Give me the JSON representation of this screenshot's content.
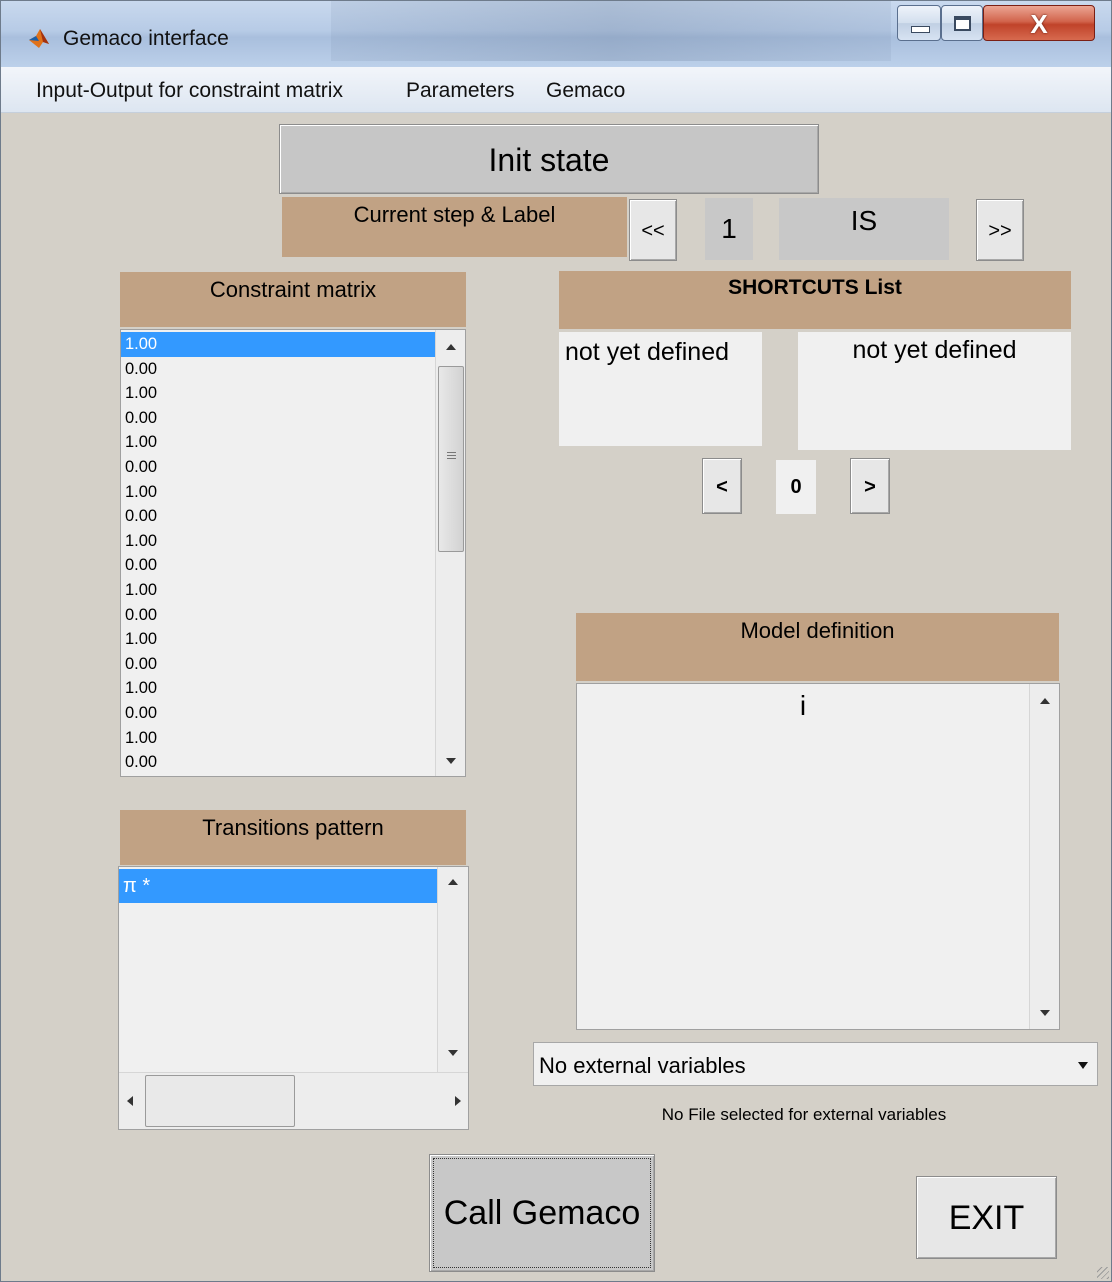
{
  "window": {
    "title": "Gemaco interface"
  },
  "menu": [
    "Input-Output for constraint matrix",
    "Parameters",
    "Gemaco"
  ],
  "init_state_button": "Init state",
  "step_panel": {
    "label": "Current step & Label",
    "prev_button": "<<",
    "step_number": "1",
    "step_label": "IS",
    "next_button": ">>"
  },
  "constraint_matrix": {
    "title": "Constraint matrix",
    "values": [
      "1.00",
      "0.00",
      "1.00",
      "0.00",
      "1.00",
      "0.00",
      "1.00",
      "0.00",
      "1.00",
      "0.00",
      "1.00",
      "0.00",
      "1.00",
      "0.00",
      "1.00",
      "0.00",
      "1.00",
      "0.00"
    ],
    "selected_index": 0
  },
  "shortcuts": {
    "title": "SHORTCUTS List",
    "left_text": "not yet defined",
    "right_text": "not yet defined",
    "prev_button": "<",
    "index": "0",
    "next_button": ">"
  },
  "model_definition": {
    "title": "Model definition",
    "content": "i"
  },
  "transitions_pattern": {
    "title": "Transitions pattern",
    "items": [
      "π *"
    ],
    "selected_index": 0
  },
  "external_variables": {
    "selected": "No external variables",
    "file_status": "No File selected for external variables"
  },
  "call_button": "Call Gemaco",
  "exit_button": "EXIT",
  "colors": {
    "tan_label": "#c1a284",
    "panel_bg": "#d4d0c8",
    "selection": "#3399ff"
  }
}
